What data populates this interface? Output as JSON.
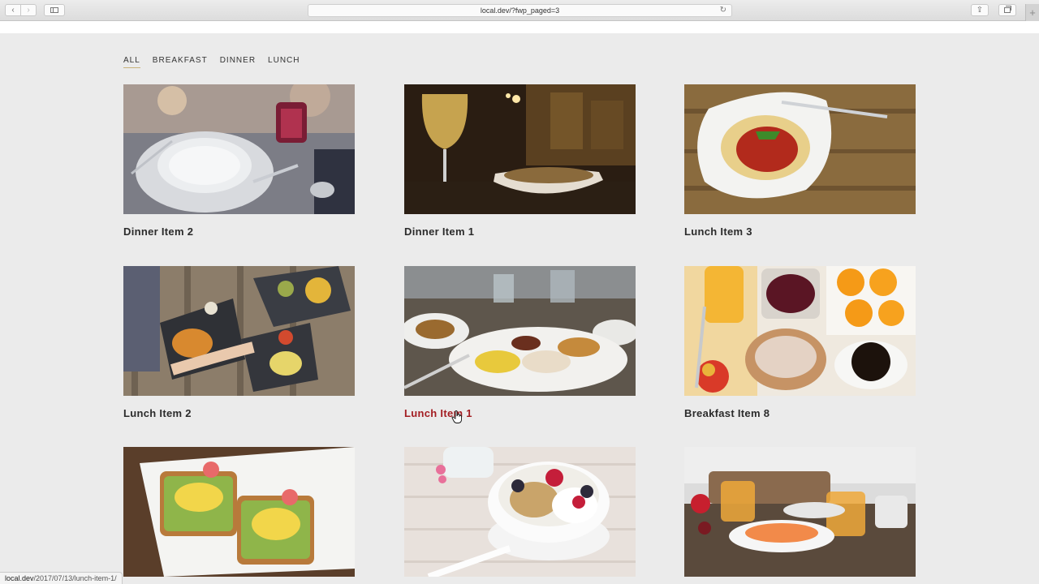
{
  "browser": {
    "url": "local.dev/?fwp_paged=3",
    "status_host": "local.dev",
    "status_path": "/2017/07/13/lunch-item-1/",
    "back_glyph": "‹",
    "forward_glyph": "›",
    "reload_glyph": "↻",
    "share_glyph": "⇪",
    "newtab_glyph": "+"
  },
  "filters": {
    "items": [
      {
        "label": "ALL",
        "active": true
      },
      {
        "label": "BREAKFAST",
        "active": false
      },
      {
        "label": "DINNER",
        "active": false
      },
      {
        "label": "LUNCH",
        "active": false
      }
    ]
  },
  "cards": [
    {
      "title": "Dinner Item 2",
      "image": "table-setting-image"
    },
    {
      "title": "Dinner Item 1",
      "image": "wine-glass-image"
    },
    {
      "title": "Lunch Item 3",
      "image": "spaghetti-image"
    },
    {
      "title": "Lunch Item 2",
      "image": "shared-plates-image"
    },
    {
      "title": "Lunch Item 1",
      "image": "grilled-plate-image",
      "hovered": true
    },
    {
      "title": "Breakfast Item 8",
      "image": "breakfast-spread-image"
    },
    {
      "title": "",
      "image": "avocado-toast-image"
    },
    {
      "title": "",
      "image": "yogurt-bowl-image"
    },
    {
      "title": "",
      "image": "brunch-table-image"
    }
  ],
  "colors": {
    "page_bg": "#ebebeb",
    "title": "#2b2b2b",
    "title_hover": "#a31d22",
    "active_filter_underline": "#c8b27a"
  }
}
